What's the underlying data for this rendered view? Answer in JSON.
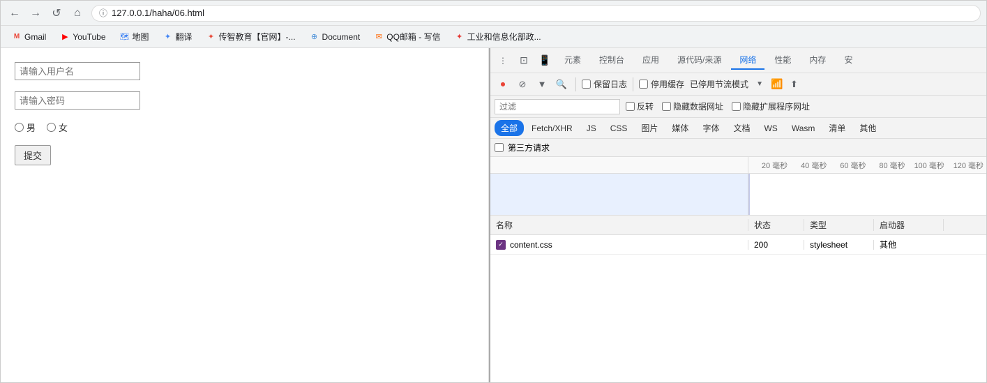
{
  "browser": {
    "nav": {
      "back_label": "←",
      "forward_label": "→",
      "reload_label": "↺",
      "home_label": "⌂",
      "address": "127.0.0.1/haha/06.html",
      "lock_icon": "🔒"
    },
    "bookmarks": [
      {
        "id": "gmail",
        "icon": "M",
        "label": "Gmail",
        "color": "#EA4335"
      },
      {
        "id": "youtube",
        "icon": "▶",
        "label": "YouTube",
        "color": "#FF0000"
      },
      {
        "id": "maps",
        "icon": "📍",
        "label": "地图",
        "color": "#4285F4"
      },
      {
        "id": "translate",
        "icon": "✦",
        "label": "翻译",
        "color": "#4285F4"
      },
      {
        "id": "chuanzhi",
        "icon": "✦",
        "label": "传智教育【官网】-...",
        "color": "#666"
      },
      {
        "id": "document",
        "icon": "⊕",
        "label": "Document",
        "color": "#4A90D9"
      },
      {
        "id": "qq",
        "icon": "✉",
        "label": "QQ邮箱 - 写信",
        "color": "#FF6600"
      },
      {
        "id": "industry",
        "icon": "✦",
        "label": "工业和信息化部政...",
        "color": "#E53935"
      }
    ]
  },
  "page": {
    "username_placeholder": "请输入用户名",
    "password_placeholder": "请输入密码",
    "radio_male": "男",
    "radio_female": "女",
    "submit_label": "提交"
  },
  "devtools": {
    "tabs": [
      {
        "id": "inspector",
        "label": "元素",
        "active": false
      },
      {
        "id": "console",
        "label": "控制台",
        "active": false
      },
      {
        "id": "application",
        "label": "应用",
        "active": false
      },
      {
        "id": "sources",
        "label": "源代码/来源",
        "active": false
      },
      {
        "id": "network",
        "label": "网络",
        "active": true
      },
      {
        "id": "performance",
        "label": "性能",
        "active": false
      },
      {
        "id": "memory",
        "label": "内存",
        "active": false
      },
      {
        "id": "security",
        "label": "安",
        "active": false
      }
    ],
    "toolbar2": {
      "record_title": "停止录制",
      "clear_title": "清除",
      "filter_title": "过滤",
      "search_title": "搜索",
      "preserve_log_label": "保留日志",
      "disable_cache_label": "停用缓存",
      "throttle_label": "已停用节流模式"
    },
    "filter": {
      "placeholder": "过滤",
      "invert_label": "反转",
      "hide_data_label": "隐藏数据网址",
      "hide_extensions_label": "隐藏扩展程序网址"
    },
    "type_filters": [
      {
        "id": "all",
        "label": "全部",
        "active": true
      },
      {
        "id": "fetch",
        "label": "Fetch/XHR",
        "active": false
      },
      {
        "id": "js",
        "label": "JS",
        "active": false
      },
      {
        "id": "css",
        "label": "CSS",
        "active": false
      },
      {
        "id": "img",
        "label": "图片",
        "active": false
      },
      {
        "id": "media",
        "label": "媒体",
        "active": false
      },
      {
        "id": "font",
        "label": "字体",
        "active": false
      },
      {
        "id": "doc",
        "label": "文档",
        "active": false
      },
      {
        "id": "ws",
        "label": "WS",
        "active": false
      },
      {
        "id": "wasm",
        "label": "Wasm",
        "active": false
      },
      {
        "id": "clear",
        "label": "清单",
        "active": false
      },
      {
        "id": "other",
        "label": "其他",
        "active": false
      }
    ],
    "third_party_label": "第三方请求",
    "timeline": {
      "ticks": [
        "20 毫秒",
        "40 毫秒",
        "60 毫秒",
        "80 毫秒",
        "100 毫秒",
        "120 毫秒"
      ]
    },
    "table": {
      "headers": {
        "name": "名称",
        "status": "状态",
        "type": "类型",
        "initiator": "启动器"
      },
      "rows": [
        {
          "name": "content.css",
          "icon": "✓",
          "status": "200",
          "type": "stylesheet",
          "initiator": "其他"
        }
      ]
    }
  }
}
